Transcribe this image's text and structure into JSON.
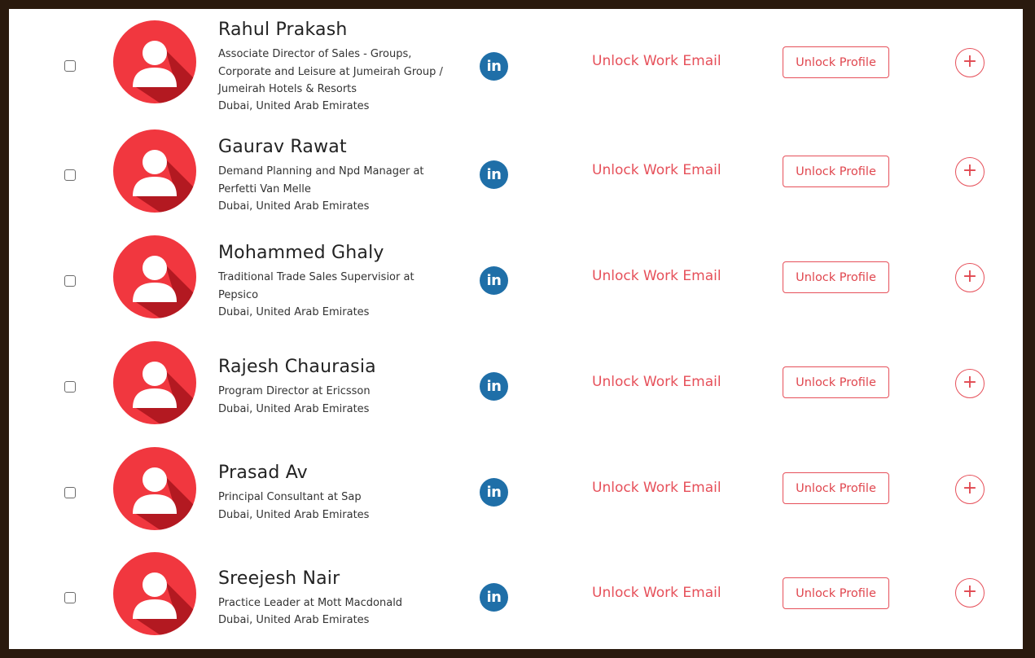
{
  "contacts": [
    {
      "name": "Rahul Prakash",
      "title": "Associate Director of Sales - Groups, Corporate and Leisure at Jumeirah Group / Jumeirah Hotels & Resorts",
      "location": "Dubai, United Arab Emirates"
    },
    {
      "name": "Gaurav Rawat",
      "title": "Demand Planning and Npd Manager at Perfetti Van Melle",
      "location": "Dubai, United Arab Emirates"
    },
    {
      "name": "Mohammed Ghaly",
      "title": "Traditional Trade Sales Supervisior at Pepsico",
      "location": "Dubai, United Arab Emirates"
    },
    {
      "name": "Rajesh Chaurasia",
      "title": "Program Director at Ericsson",
      "location": "Dubai, United Arab Emirates"
    },
    {
      "name": "Prasad Av",
      "title": "Principal Consultant at Sap",
      "location": "Dubai, United Arab Emirates"
    },
    {
      "name": "Sreejesh Nair",
      "title": "Practice Leader at Mott Macdonald",
      "location": "Dubai, United Arab Emirates"
    }
  ],
  "labels": {
    "unlock_email": "Unlock Work Email",
    "unlock_profile": "Unlock Profile",
    "add": "+",
    "linkedin": "in"
  },
  "icons": {
    "avatar": "user-avatar-icon",
    "linkedin": "linkedin-icon",
    "add": "plus-circle-icon"
  },
  "colors": {
    "accent": "#e6505a",
    "avatar_bg": "#f1373f",
    "avatar_shadow": "#a8141c",
    "linkedin": "#1f6fa8"
  }
}
